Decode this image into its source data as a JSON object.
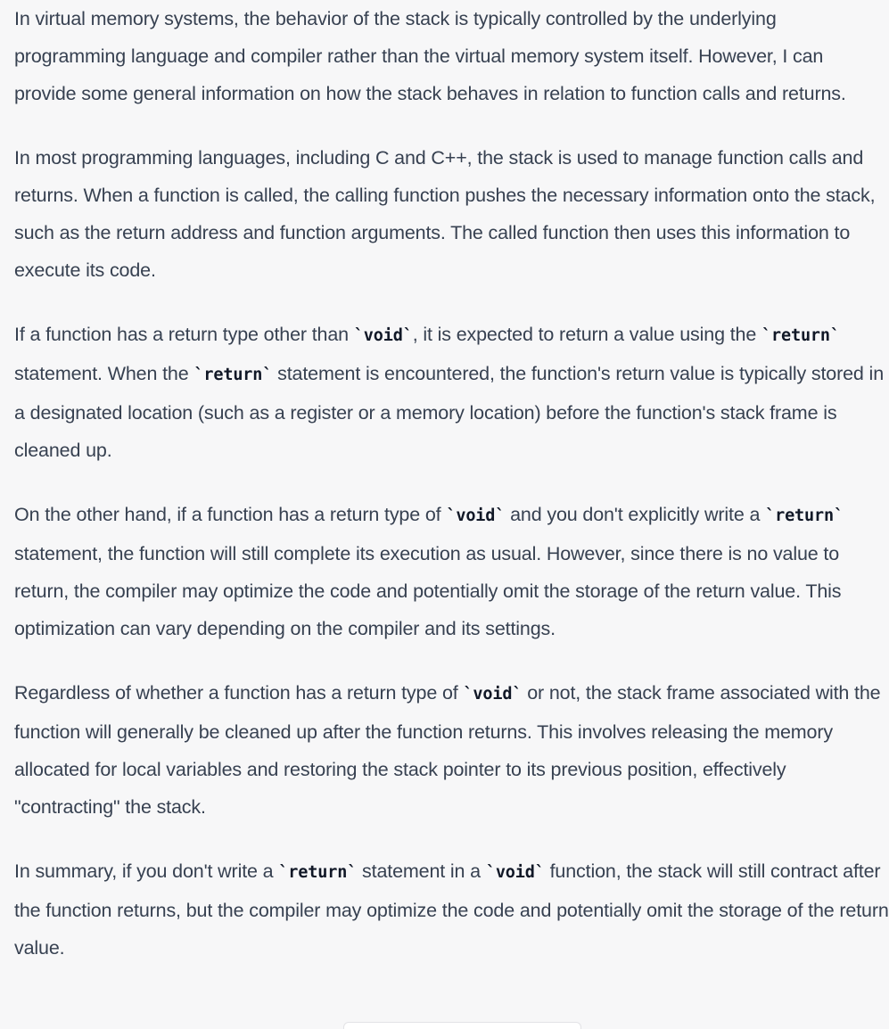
{
  "paragraphs": [
    {
      "segments": [
        {
          "text": "In virtual memory systems, the behavior of the stack is typically controlled by the underlying programming language and compiler rather than the virtual memory system itself. However, I can provide some general information on how the stack behaves in relation to function calls and returns."
        }
      ]
    },
    {
      "segments": [
        {
          "text": "In most programming languages, including C and C++, the stack is used to manage function calls and returns. When a function is called, the calling function pushes the necessary information onto the stack, such as the return address and function arguments. The called function then uses this information to execute its code."
        }
      ]
    },
    {
      "segments": [
        {
          "text": "If a function has a return type other than "
        },
        {
          "code": "void"
        },
        {
          "text": ", it is expected to return a value using the "
        },
        {
          "code": "return"
        },
        {
          "text": " statement. When the "
        },
        {
          "code": "return"
        },
        {
          "text": " statement is encountered, the function's return value is typically stored in a designated location (such as a register or a memory location) before the function's stack frame is cleaned up."
        }
      ]
    },
    {
      "segments": [
        {
          "text": "On the other hand, if a function has a return type of "
        },
        {
          "code": "void"
        },
        {
          "text": " and you don't explicitly write a "
        },
        {
          "code": "return"
        },
        {
          "text": " statement, the function will still complete its execution as usual. However, since there is no value to return, the compiler may optimize the code and potentially omit the storage of the return value. This optimization can vary depending on the compiler and its settings."
        }
      ]
    },
    {
      "segments": [
        {
          "text": "Regardless of whether a function has a return type of "
        },
        {
          "code": "void"
        },
        {
          "text": " or not, the stack frame associated with the function will generally be cleaned up after the function returns. This involves releasing the memory allocated for local variables and restoring the stack pointer to its previous position, effectively \"contracting\" the stack."
        }
      ]
    },
    {
      "segments": [
        {
          "text": "In summary, if you don't write a "
        },
        {
          "code": "return"
        },
        {
          "text": " statement in a "
        },
        {
          "code": "void"
        },
        {
          "text": " function, the stack will still contract after the function returns, but the compiler may optimize the code and potentially omit the storage of the return value."
        }
      ]
    }
  ],
  "colors": {
    "background": "#f7f7f8",
    "text": "#374151",
    "code_text": "#111827"
  }
}
